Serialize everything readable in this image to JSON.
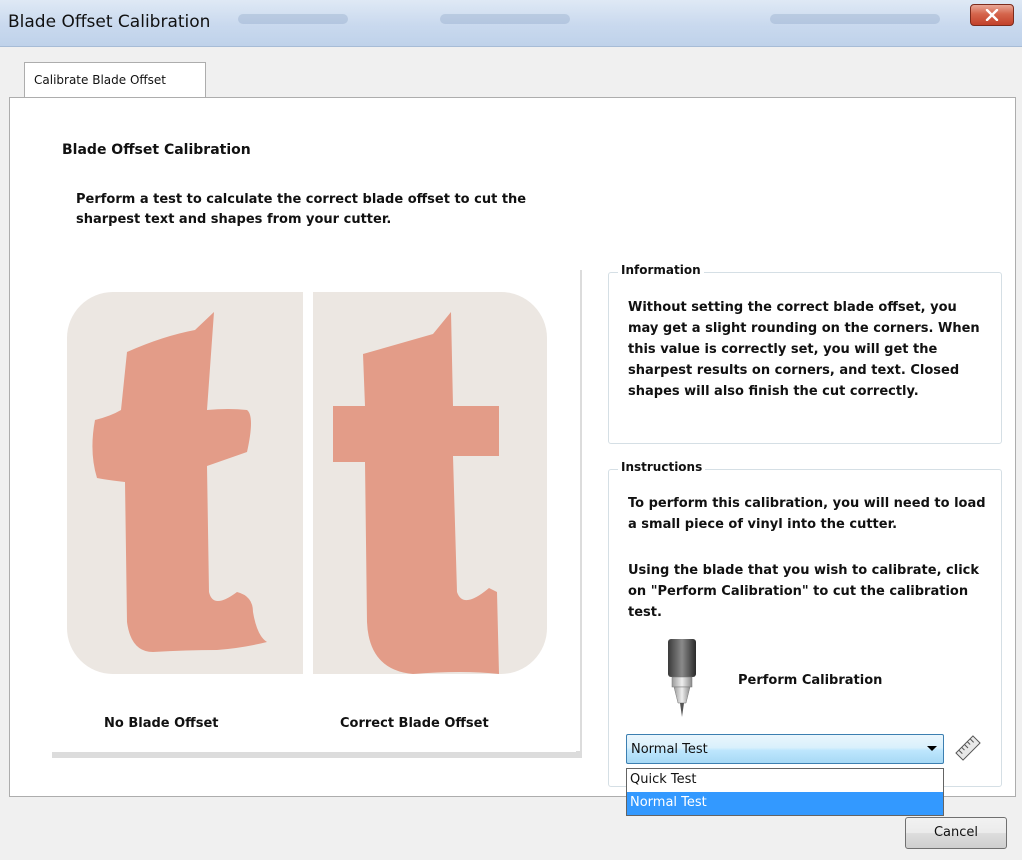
{
  "window": {
    "title": "Blade Offset Calibration"
  },
  "tab": {
    "label": "Calibrate Blade Offset"
  },
  "main": {
    "heading": "Blade Offset Calibration",
    "description": "Perform a test to calculate the correct blade offset to cut the sharpest text and shapes from your cutter.",
    "images": {
      "left_caption": "No Blade Offset",
      "right_caption": "Correct Blade Offset"
    }
  },
  "information": {
    "title": "Information",
    "text": "Without setting the correct blade offset, you may get a slight rounding on the corners. When this value is correctly set, you will get the sharpest results on corners, and text. Closed shapes will also finish the cut correctly."
  },
  "instructions": {
    "title": "Instructions",
    "paragraph1": "To perform this calibration, you will need to load a small piece of vinyl into the cutter.",
    "paragraph2": "Using the blade that you wish to calibrate,  click on \"Perform Calibration\" to cut the calibration test.",
    "perform_label": "Perform Calibration"
  },
  "test_select": {
    "value": "Normal Test",
    "options": [
      "Quick Test",
      "Normal Test"
    ],
    "selected_index": 1
  },
  "footer": {
    "cancel_label": "Cancel"
  },
  "colors": {
    "vinyl": "#e39c88",
    "selection": "#3399ff",
    "combo_border": "#3c7fb1"
  }
}
